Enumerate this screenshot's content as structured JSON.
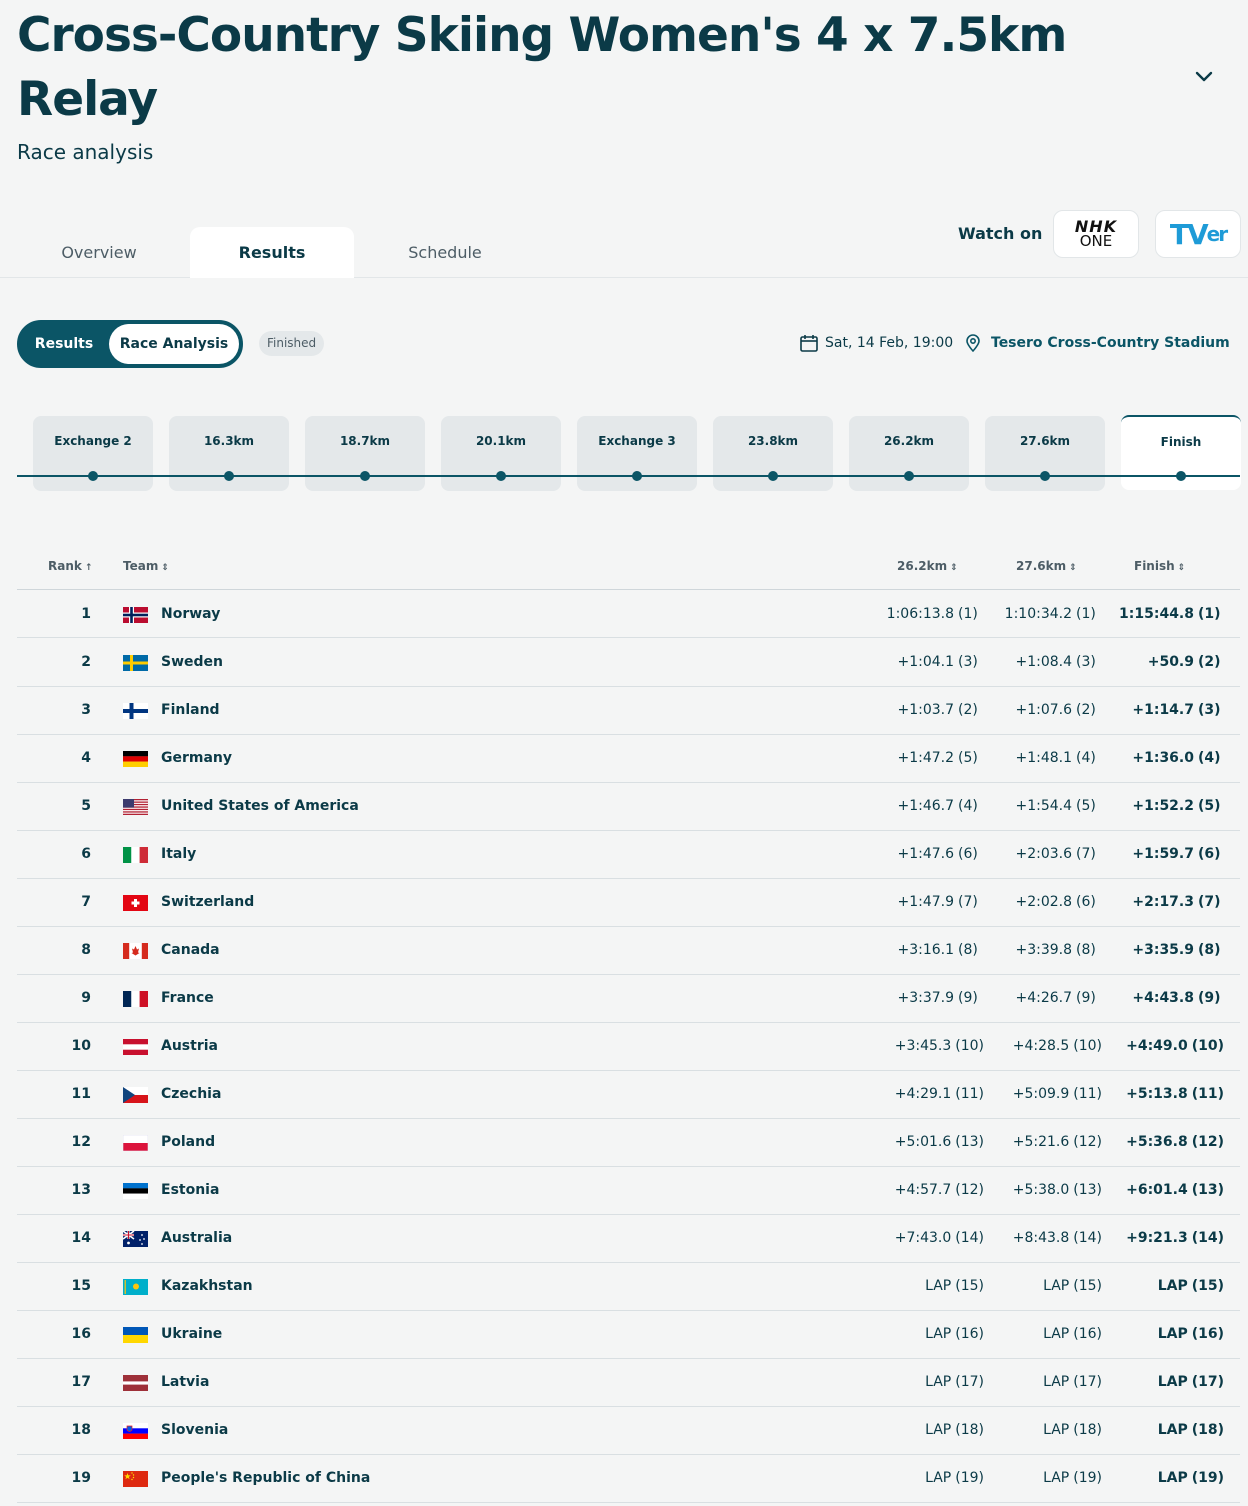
{
  "header": {
    "title": "Cross-Country Skiing Women's 4 x 7.5km Relay",
    "subtitle": "Race analysis"
  },
  "tabs": [
    {
      "label": "Overview"
    },
    {
      "label": "Results"
    },
    {
      "label": "Schedule"
    }
  ],
  "watch": {
    "label": "Watch on",
    "nhk_top": "NHK",
    "nhk_bottom": "ONE",
    "tver_main": "TV",
    "tver_sub": "er"
  },
  "toggle": {
    "results": "Results",
    "analysis": "Race Analysis"
  },
  "status": "Finished",
  "event": {
    "date": "Sat, 14 Feb, 19:00",
    "venue": "Tesero Cross-Country Stadium"
  },
  "checkpoints": [
    "Exchange 2",
    "16.3km",
    "18.7km",
    "20.1km",
    "Exchange 3",
    "23.8km",
    "26.2km",
    "27.6km",
    "Finish"
  ],
  "columns": {
    "rank": "Rank",
    "team": "Team",
    "c1": "26.2km",
    "c2": "27.6km",
    "c3": "Finish"
  },
  "rows": [
    {
      "rank": "1",
      "team": "Norway",
      "c1": "1:06:13.8",
      "r1": "(1)",
      "c2": "1:10:34.2",
      "r2": "(1)",
      "c3": "1:15:44.8",
      "r3": "(1)"
    },
    {
      "rank": "2",
      "team": "Sweden",
      "c1": "+1:04.1",
      "r1": "(3)",
      "c2": "+1:08.4",
      "r2": "(3)",
      "c3": "+50.9",
      "r3": "(2)"
    },
    {
      "rank": "3",
      "team": "Finland",
      "c1": "+1:03.7",
      "r1": "(2)",
      "c2": "+1:07.6",
      "r2": "(2)",
      "c3": "+1:14.7",
      "r3": "(3)"
    },
    {
      "rank": "4",
      "team": "Germany",
      "c1": "+1:47.2",
      "r1": "(5)",
      "c2": "+1:48.1",
      "r2": "(4)",
      "c3": "+1:36.0",
      "r3": "(4)"
    },
    {
      "rank": "5",
      "team": "United States of America",
      "c1": "+1:46.7",
      "r1": "(4)",
      "c2": "+1:54.4",
      "r2": "(5)",
      "c3": "+1:52.2",
      "r3": "(5)"
    },
    {
      "rank": "6",
      "team": "Italy",
      "c1": "+1:47.6",
      "r1": "(6)",
      "c2": "+2:03.6",
      "r2": "(7)",
      "c3": "+1:59.7",
      "r3": "(6)"
    },
    {
      "rank": "7",
      "team": "Switzerland",
      "c1": "+1:47.9",
      "r1": "(7)",
      "c2": "+2:02.8",
      "r2": "(6)",
      "c3": "+2:17.3",
      "r3": "(7)"
    },
    {
      "rank": "8",
      "team": "Canada",
      "c1": "+3:16.1",
      "r1": "(8)",
      "c2": "+3:39.8",
      "r2": "(8)",
      "c3": "+3:35.9",
      "r3": "(8)"
    },
    {
      "rank": "9",
      "team": "France",
      "c1": "+3:37.9",
      "r1": "(9)",
      "c2": "+4:26.7",
      "r2": "(9)",
      "c3": "+4:43.8",
      "r3": "(9)"
    },
    {
      "rank": "10",
      "team": "Austria",
      "c1": "+3:45.3",
      "r1": "(10)",
      "c2": "+4:28.5",
      "r2": "(10)",
      "c3": "+4:49.0",
      "r3": "(10)"
    },
    {
      "rank": "11",
      "team": "Czechia",
      "c1": "+4:29.1",
      "r1": "(11)",
      "c2": "+5:09.9",
      "r2": "(11)",
      "c3": "+5:13.8",
      "r3": "(11)"
    },
    {
      "rank": "12",
      "team": "Poland",
      "c1": "+5:01.6",
      "r1": "(13)",
      "c2": "+5:21.6",
      "r2": "(12)",
      "c3": "+5:36.8",
      "r3": "(12)"
    },
    {
      "rank": "13",
      "team": "Estonia",
      "c1": "+4:57.7",
      "r1": "(12)",
      "c2": "+5:38.0",
      "r2": "(13)",
      "c3": "+6:01.4",
      "r3": "(13)"
    },
    {
      "rank": "14",
      "team": "Australia",
      "c1": "+7:43.0",
      "r1": "(14)",
      "c2": "+8:43.8",
      "r2": "(14)",
      "c3": "+9:21.3",
      "r3": "(14)"
    },
    {
      "rank": "15",
      "team": "Kazakhstan",
      "c1": "LAP",
      "r1": "(15)",
      "c2": "LAP",
      "r2": "(15)",
      "c3": "LAP",
      "r3": "(15)"
    },
    {
      "rank": "16",
      "team": "Ukraine",
      "c1": "LAP",
      "r1": "(16)",
      "c2": "LAP",
      "r2": "(16)",
      "c3": "LAP",
      "r3": "(16)"
    },
    {
      "rank": "17",
      "team": "Latvia",
      "c1": "LAP",
      "r1": "(17)",
      "c2": "LAP",
      "r2": "(17)",
      "c3": "LAP",
      "r3": "(17)"
    },
    {
      "rank": "18",
      "team": "Slovenia",
      "c1": "LAP",
      "r1": "(18)",
      "c2": "LAP",
      "r2": "(18)",
      "c3": "LAP",
      "r3": "(18)"
    },
    {
      "rank": "19",
      "team": "People's Republic of China",
      "c1": "LAP",
      "r1": "(19)",
      "c2": "LAP",
      "r2": "(19)",
      "c3": "LAP",
      "r3": "(19)"
    }
  ],
  "colors": {
    "primary": "#0b3a47",
    "accent": "#0b5566",
    "background": "#f4f5f5"
  }
}
